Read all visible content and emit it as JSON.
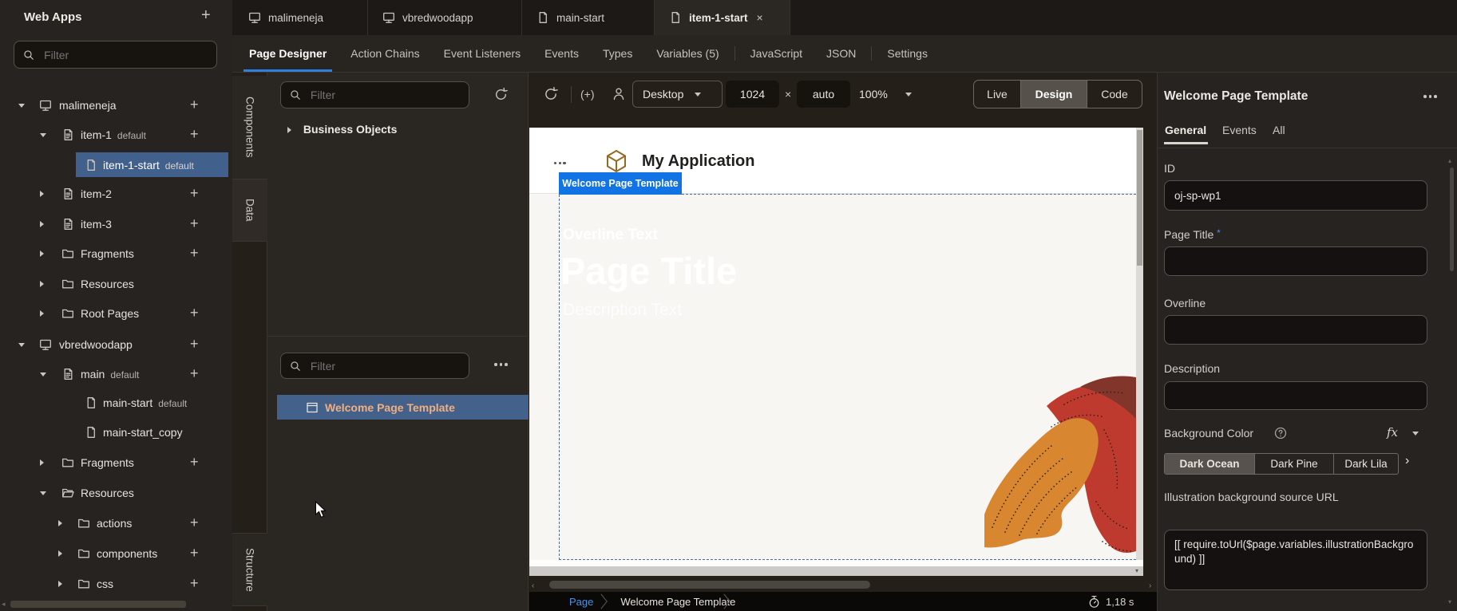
{
  "sidebar": {
    "title": "Web Apps",
    "add_label": "+",
    "filter_placeholder": "Filter",
    "tree": [
      {
        "label": "malimeneja"
      },
      {
        "label": "item-1",
        "suffix": "default"
      },
      {
        "label": "item-1-start",
        "suffix": "default"
      },
      {
        "label": "item-2"
      },
      {
        "label": "item-3"
      },
      {
        "label": "Fragments"
      },
      {
        "label": "Resources"
      },
      {
        "label": "Root Pages"
      },
      {
        "label": "vbredwoodapp"
      },
      {
        "label": "main",
        "suffix": "default"
      },
      {
        "label": "main-start",
        "suffix": "default"
      },
      {
        "label": "main-start_copy"
      },
      {
        "label": "Fragments"
      },
      {
        "label": "Resources"
      },
      {
        "label": "actions"
      },
      {
        "label": "components"
      },
      {
        "label": "css"
      }
    ]
  },
  "app_tabs": [
    {
      "label": "malimeneja"
    },
    {
      "label": "vbredwoodapp"
    },
    {
      "label": "main-start"
    },
    {
      "label": "item-1-start",
      "close": "×"
    }
  ],
  "designer_tabs": [
    {
      "label": "Page Designer"
    },
    {
      "label": "Action Chains"
    },
    {
      "label": "Event Listeners"
    },
    {
      "label": "Events"
    },
    {
      "label": "Types"
    },
    {
      "label": "Variables (5)"
    },
    {
      "label": "JavaScript"
    },
    {
      "label": "JSON"
    },
    {
      "label": "Settings"
    }
  ],
  "palette": {
    "components_tab": "Components",
    "data_tab": "Data",
    "structure_tab": "Structure",
    "filter_placeholder": "Filter",
    "business_objects": "Business Objects"
  },
  "structure": {
    "filter_placeholder": "Filter",
    "selected_item": "Welcome Page Template"
  },
  "canvas": {
    "toolbar": {
      "device": "Desktop",
      "width_value": "1024",
      "times": "×",
      "height_value": "auto",
      "zoom": "100%",
      "live": "Live",
      "design": "Design",
      "code": "Code",
      "pointer_glyph": "(+)"
    },
    "page": {
      "app_title": "My Application",
      "selection_label": "Welcome Page Template",
      "overline": "Overline Text",
      "title": "Page Title",
      "description": "Description Text"
    },
    "statusbar": {
      "crumb1": "Page",
      "crumb2": "Welcome Page Template",
      "timer": "1,18 s"
    }
  },
  "props": {
    "title": "Welcome Page Template",
    "tab_general": "General",
    "tab_events": "Events",
    "tab_all": "All",
    "id_label": "ID",
    "id_value": "oj-sp-wp1",
    "page_title_label": "Page Title",
    "required_mark": "*",
    "overline_label": "Overline",
    "description_label": "Description",
    "bg_color_label": "Background Color",
    "fx_label": "fx",
    "preset1": "Dark Ocean",
    "preset2": "Dark Pine",
    "preset3": "Dark Lila",
    "illustration_label": "Illustration background source URL",
    "illustration_value": "[[ require.toUrl($page.variables.illustrationBackground) ]]"
  },
  "colors": {
    "accent_blue": "#1173E4",
    "tab_underline_blue": "#2E7FE0",
    "tree_selection_blue": "#41608C",
    "link_blue": "#4A93EA",
    "structure_item_text": "#F0AF7D",
    "canvas_bg": "#F7F6F3",
    "shoe_orange": "#D8862F",
    "shoe_red": "#BE3A2F",
    "shoe_maroon": "#81352B"
  }
}
